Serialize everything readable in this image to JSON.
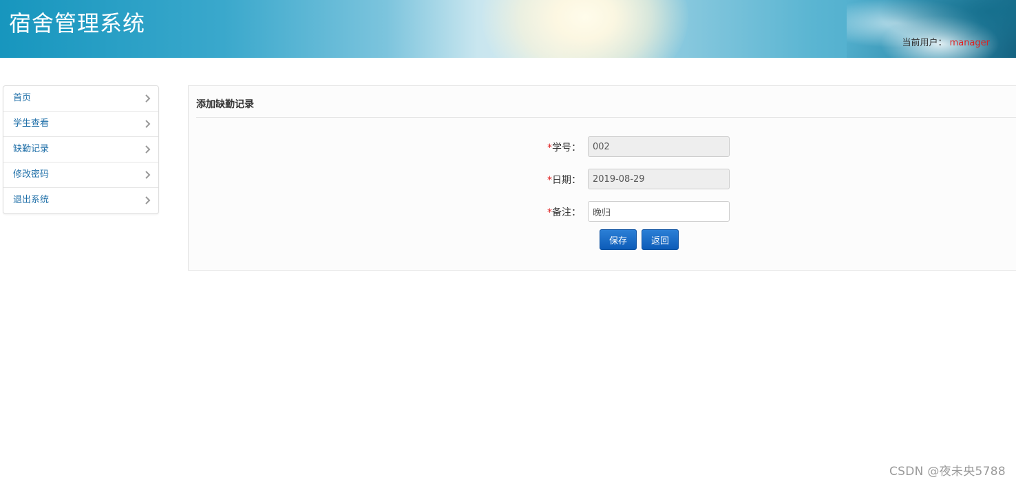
{
  "header": {
    "title": "宿舍管理系统",
    "user_label": "当前用户：",
    "user_name": "manager"
  },
  "sidebar": {
    "items": [
      {
        "label": "首页"
      },
      {
        "label": "学生查看"
      },
      {
        "label": "缺勤记录"
      },
      {
        "label": "修改密码"
      },
      {
        "label": "退出系统"
      }
    ]
  },
  "form": {
    "title": "添加缺勤记录",
    "required_mark": "*",
    "fields": [
      {
        "label": "学号：",
        "value": "002",
        "readonly": true
      },
      {
        "label": "日期：",
        "value": "2019-08-29",
        "readonly": true
      },
      {
        "label": "备注：",
        "value": "晚归",
        "readonly": false
      }
    ],
    "save_label": "保存",
    "back_label": "返回"
  },
  "watermark": "CSDN @夜未央5788",
  "colors": {
    "link": "#1f6fa8",
    "required": "#e02020",
    "button": "#0d5cb8"
  }
}
